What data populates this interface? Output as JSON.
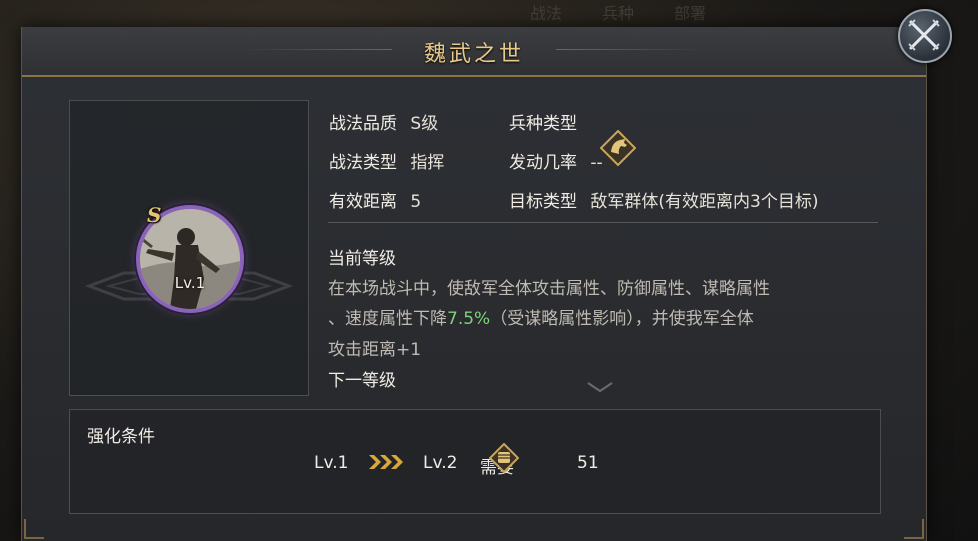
{
  "background_tabs": [
    "战法",
    "兵种",
    "部署"
  ],
  "dialog": {
    "title": "魏武之世"
  },
  "portrait": {
    "grade_badge": "S",
    "level": "Lv.1"
  },
  "attributes": {
    "quality_label": "战法品质",
    "quality_value": "S级",
    "type_label": "战法类型",
    "type_value": "指挥",
    "range_label": "有效距离",
    "range_value": "5",
    "troop_label": "兵种类型",
    "troop_icon": "horse-head-icon",
    "trigger_label": "发动几率",
    "trigger_value": "--",
    "target_label": "目标类型",
    "target_value": "敌军群体(有效距离内3个目标)"
  },
  "description": {
    "current_heading": "当前等级",
    "line1": "在本场战斗中，使敌军全体攻击属性、防御属性、谋略属性",
    "line2_a": "、速度属性下降",
    "line2_hi": "7.5%",
    "line2_b": "（受谋略属性影响），并使我军全体",
    "line3": "攻击距离+1",
    "next_heading": "下一等级"
  },
  "enhance": {
    "title": "强化条件",
    "from_level": "Lv.1",
    "to_level": "Lv.2",
    "require_label": "需要",
    "cost": "51",
    "cost_icon": "fist-token-icon"
  },
  "colors": {
    "title_gold": "#e8c98a",
    "highlight_green": "#7fd27a",
    "avatar_ring_purple": "#8a64b8"
  }
}
